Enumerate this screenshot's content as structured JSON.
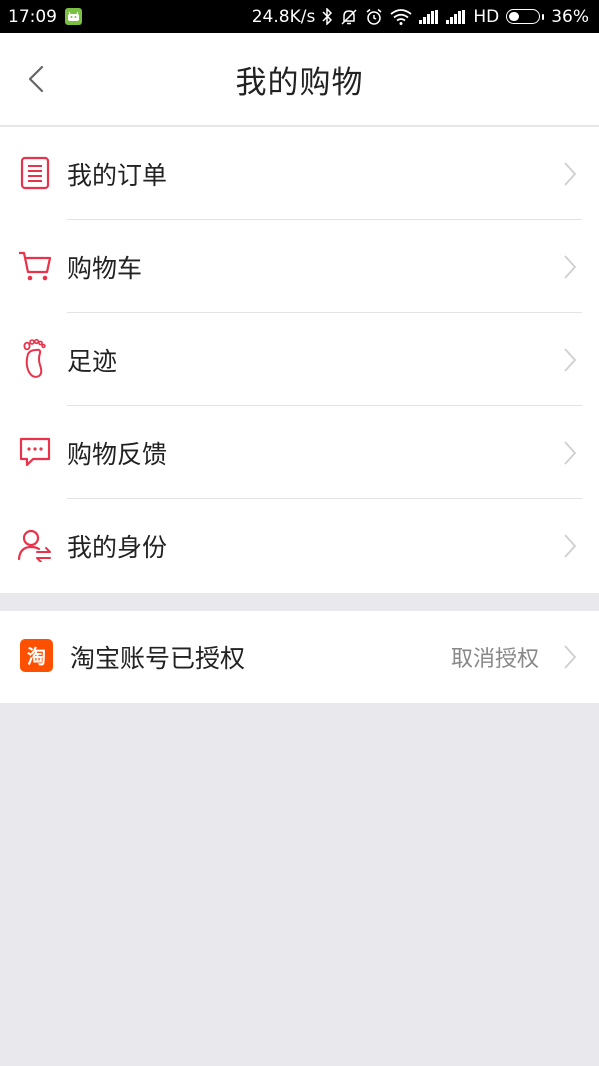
{
  "status_bar": {
    "time": "17:09",
    "net_speed": "24.8K/s",
    "network_type": "HD",
    "battery": "36%",
    "battery_level": 0.36
  },
  "nav": {
    "title": "我的购物",
    "back_icon": "chevron-left-icon"
  },
  "menu": [
    {
      "label": "我的订单",
      "icon": "order-list-icon"
    },
    {
      "label": "购物车",
      "icon": "cart-icon"
    },
    {
      "label": "足迹",
      "icon": "footprint-icon"
    },
    {
      "label": "购物反馈",
      "icon": "chat-bubble-icon"
    },
    {
      "label": "我的身份",
      "icon": "user-switch-icon"
    }
  ],
  "taobao": {
    "logo_char": "淘",
    "label": "淘宝账号已授权",
    "action_label": "取消授权"
  },
  "colors": {
    "accent": "#e8334a",
    "taobao_orange": "#ff5000",
    "background": "#e8e8ed"
  }
}
